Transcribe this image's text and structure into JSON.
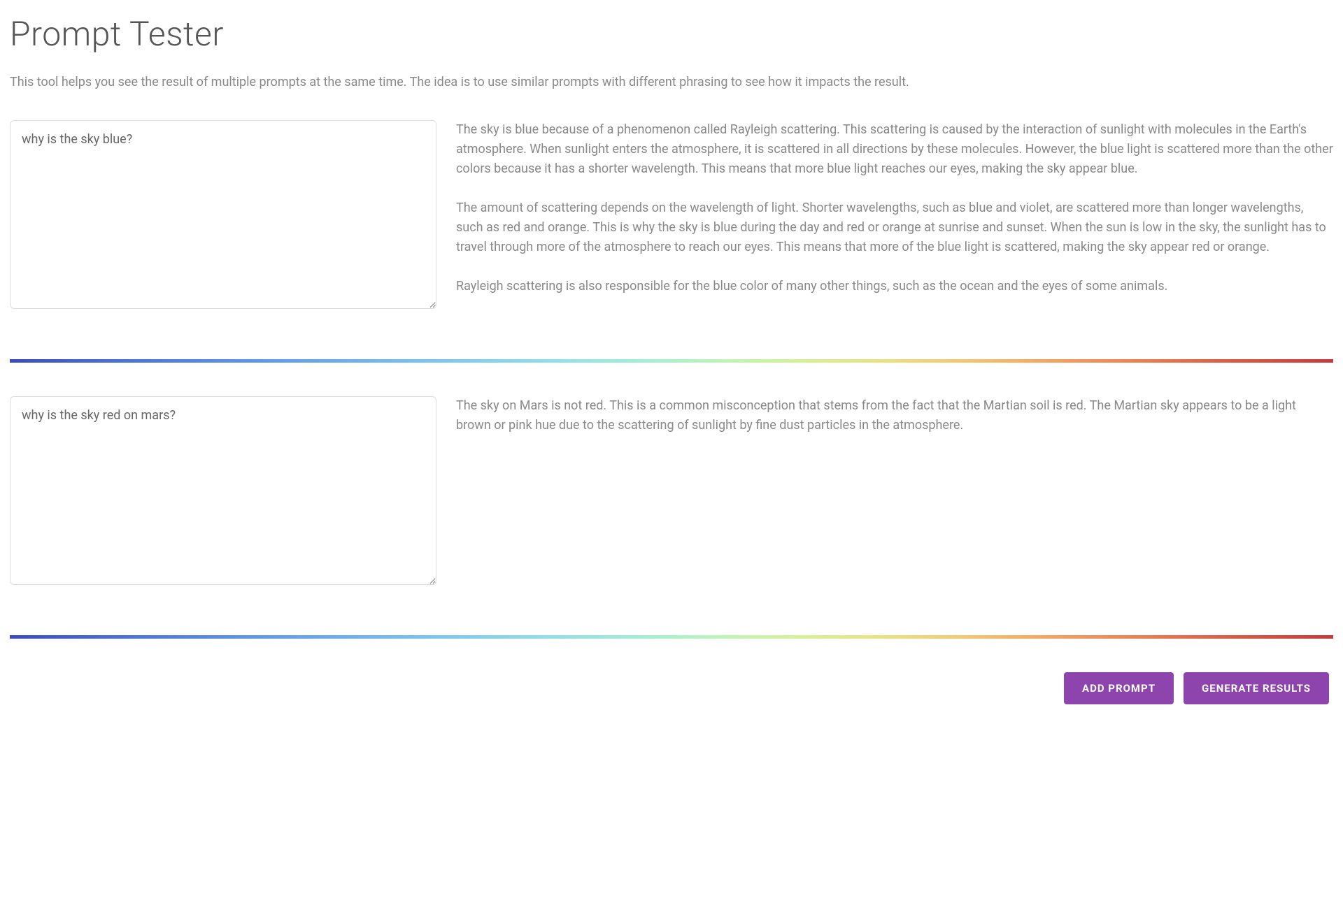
{
  "header": {
    "title": "Prompt Tester",
    "description": "This tool helps you see the result of multiple prompts at the same time. The idea is to use similar prompts with different phrasing to see how it impacts the result."
  },
  "prompts": [
    {
      "input": "why is the sky blue?",
      "result_paragraphs": [
        "The sky is blue because of a phenomenon called Rayleigh scattering. This scattering is caused by the interaction of sunlight with molecules in the Earth's atmosphere. When sunlight enters the atmosphere, it is scattered in all directions by these molecules. However, the blue light is scattered more than the other colors because it has a shorter wavelength. This means that more blue light reaches our eyes, making the sky appear blue.",
        "The amount of scattering depends on the wavelength of light. Shorter wavelengths, such as blue and violet, are scattered more than longer wavelengths, such as red and orange. This is why the sky is blue during the day and red or orange at sunrise and sunset. When the sun is low in the sky, the sunlight has to travel through more of the atmosphere to reach our eyes. This means that more of the blue light is scattered, making the sky appear red or orange.",
        "Rayleigh scattering is also responsible for the blue color of many other things, such as the ocean and the eyes of some animals."
      ]
    },
    {
      "input": "why is the sky red on mars?",
      "result_paragraphs": [
        "The sky on Mars is not red. This is a common misconception that stems from the fact that the Martian soil is red. The Martian sky appears to be a light brown or pink hue due to the scattering of sunlight by fine dust particles in the atmosphere."
      ]
    }
  ],
  "buttons": {
    "add_prompt": "ADD PROMPT",
    "generate_results": "GENERATE RESULTS"
  }
}
